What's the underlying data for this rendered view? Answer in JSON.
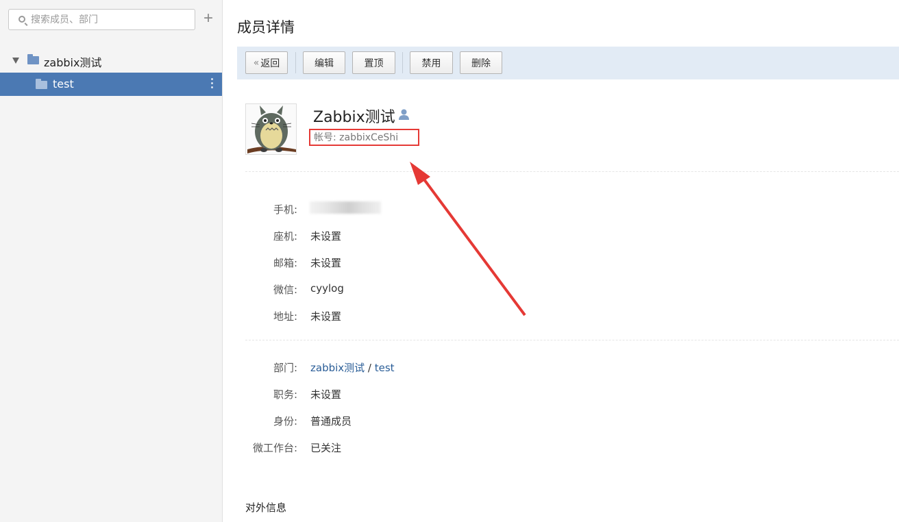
{
  "sidebar": {
    "search_placeholder": "搜索成员、部门",
    "add_label": "+",
    "tree": {
      "root_label": "zabbix测试",
      "child_label": "test"
    }
  },
  "main": {
    "page_title": "成员详情",
    "toolbar": {
      "back": "返回",
      "edit": "编辑",
      "pin": "置顶",
      "disable": "禁用",
      "delete": "删除"
    },
    "profile": {
      "name": "Zabbix测试",
      "account_label": "帐号:",
      "account_value": "zabbixCeShi"
    },
    "contact": {
      "phone_label": "手机:",
      "landline_label": "座机:",
      "landline_value": "未设置",
      "email_label": "邮箱:",
      "email_value": "未设置",
      "wechat_label": "微信:",
      "wechat_value": "cyylog",
      "address_label": "地址:",
      "address_value": "未设置"
    },
    "org": {
      "dept_label": "部门:",
      "dept_parent": "zabbix测试",
      "dept_sep": " / ",
      "dept_child": "test",
      "position_label": "职务:",
      "position_value": "未设置",
      "identity_label": "身份:",
      "identity_value": "普通成员",
      "workbench_label": "微工作台:",
      "workbench_value": "已关注"
    },
    "external_title": "对外信息"
  },
  "colors": {
    "toolbar_bg": "#e2ebf5",
    "selected_bg": "#4b79b3",
    "link": "#2a5d97",
    "annotation_red": "#e53935"
  }
}
